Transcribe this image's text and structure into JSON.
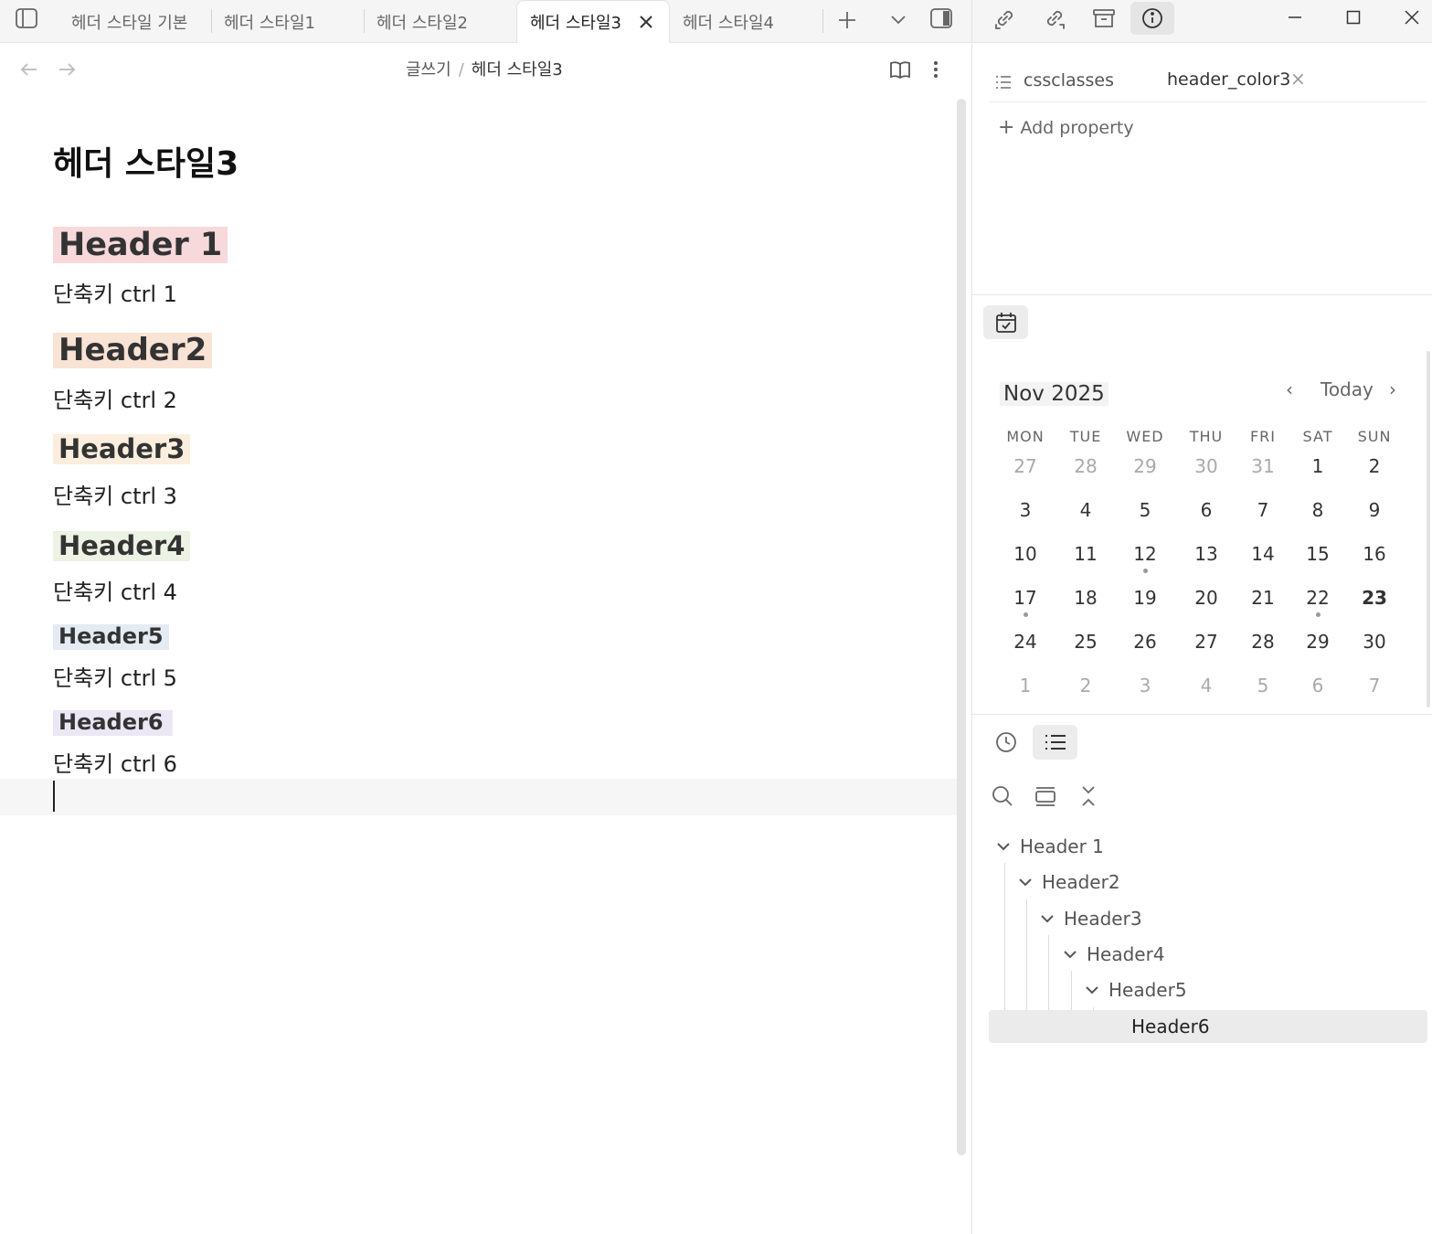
{
  "tabs": [
    {
      "label": "헤더 스타일 기본",
      "active": false
    },
    {
      "label": "헤더 스타일1",
      "active": false
    },
    {
      "label": "헤더 스타일2",
      "active": false
    },
    {
      "label": "헤더 스타일3",
      "active": true
    },
    {
      "label": "헤더 스타일4",
      "active": false
    }
  ],
  "breadcrumb": {
    "folder": "글쓰기",
    "separator": "/",
    "current": "헤더 스타일3"
  },
  "note": {
    "title": "헤더 스타일3",
    "headers": [
      "Header 1",
      "Header2",
      "Header3",
      "Header4",
      "Header5",
      "Header6"
    ],
    "lines": [
      "단축키 ctrl 1",
      "단축키 ctrl 2",
      "단축키 ctrl 3",
      "단축키 ctrl 4",
      "단축키 ctrl 5",
      "단축키 ctrl 6"
    ]
  },
  "properties": {
    "key": "cssclasses",
    "value": "header_color3",
    "remove_glyph": "×",
    "add_label": "Add property",
    "add_glyph": "+"
  },
  "calendar": {
    "month": "Nov 2025",
    "today_label": "Today",
    "prev_glyph": "‹",
    "next_glyph": "›",
    "weekdays": [
      "MON",
      "TUE",
      "WED",
      "THU",
      "FRI",
      "SAT",
      "SUN"
    ],
    "weeks": [
      [
        "27",
        "28",
        "29",
        "30",
        "31",
        "1",
        "2"
      ],
      [
        "3",
        "4",
        "5",
        "6",
        "7",
        "8",
        "9"
      ],
      [
        "10",
        "11",
        "12",
        "13",
        "14",
        "15",
        "16"
      ],
      [
        "17",
        "18",
        "19",
        "20",
        "21",
        "22",
        "23"
      ],
      [
        "24",
        "25",
        "26",
        "27",
        "28",
        "29",
        "30"
      ],
      [
        "1",
        "2",
        "3",
        "4",
        "5",
        "6",
        "7"
      ]
    ]
  },
  "outline": {
    "items": [
      "Header 1",
      "Header2",
      "Header3",
      "Header4",
      "Header5",
      "Header6"
    ]
  },
  "icons": {
    "sidebar_toggle": "sidebar-left-icon",
    "new_tab": "plus-icon",
    "tab_list": "chevron-down-icon",
    "right_sidebar_toggle": "sidebar-right-icon",
    "backlinks": "link-in-icon",
    "outgoing_links": "link-out-icon",
    "archive": "archive-icon",
    "file_info": "info-icon",
    "reading_view": "book-open-icon",
    "more_options": "more-vertical-icon",
    "calendar": "calendar-check-icon",
    "recent": "clock-icon",
    "outline": "list-icon",
    "search": "search-icon",
    "expand_all": "expand-icon",
    "collapse_all": "collapse-icon"
  }
}
